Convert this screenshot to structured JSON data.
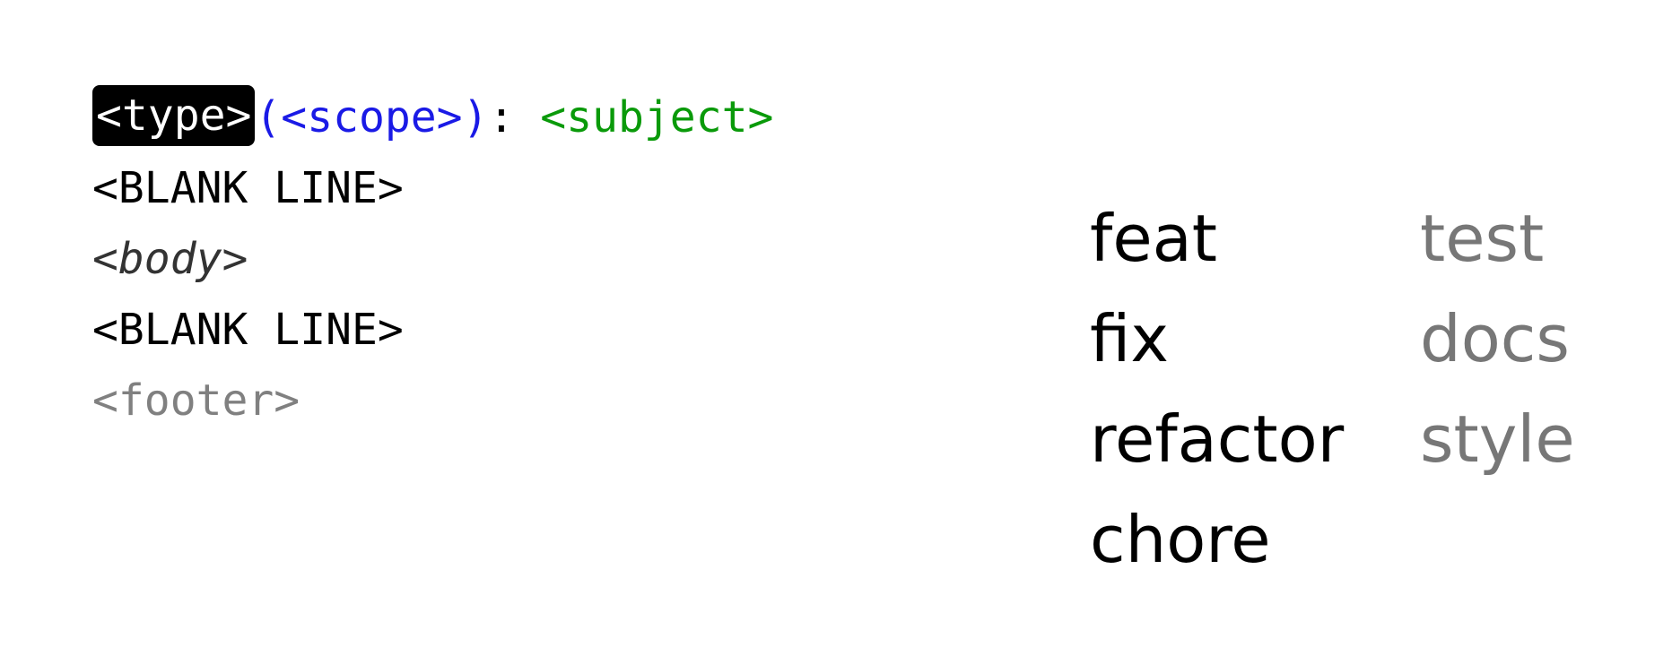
{
  "format": {
    "type": "<type>",
    "scope": "(<scope>)",
    "colon": ":",
    "subject": "<subject>",
    "blank_line_1": "<BLANK LINE>",
    "body": "<body>",
    "blank_line_2": "<BLANK LINE>",
    "footer": "<footer>"
  },
  "types": {
    "major": [
      "feat",
      "fix",
      "refactor",
      "chore"
    ],
    "minor": [
      "test",
      "docs",
      "style"
    ]
  },
  "colors": {
    "type_bg": "#000000",
    "scope": "#1a1ae6",
    "subject": "#0a9a0a",
    "footer": "#808080",
    "minor_types": "#777777"
  }
}
